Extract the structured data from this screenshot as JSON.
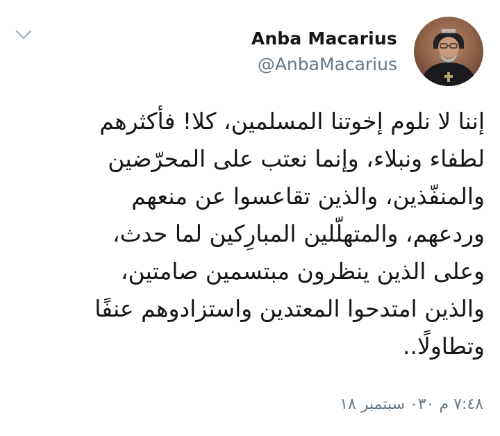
{
  "tweet": {
    "display_name": "Anba Macarius",
    "handle": "@AnbaMacarius",
    "lines": [
      "إننا لا نلوم إخوتنا المسلمين، كلا! فأكثرهم",
      "لطفاء ونبلاء، وإنما نعتب على المحرّضين",
      "والمنفّذين،  والذين تقاعسوا عن منعهم",
      "وردعهم، والمتهلّلين المبارِكين لما حدث،",
      "وعلى الذين ينظرون مبتسمين صامتين،",
      "والذين امتدحوا المعتدين واستزادوهم عنفًا",
      "وتطاولًا.."
    ],
    "timestamp": "٧:٤٨ م ٠٣٠ سبتمبر ١٨"
  },
  "icons": {
    "menu": "chevron-down-icon",
    "avatar": "avatar-image"
  },
  "colors": {
    "text": "#14171a",
    "secondary": "#657786",
    "chevron": "#aab8c2"
  }
}
